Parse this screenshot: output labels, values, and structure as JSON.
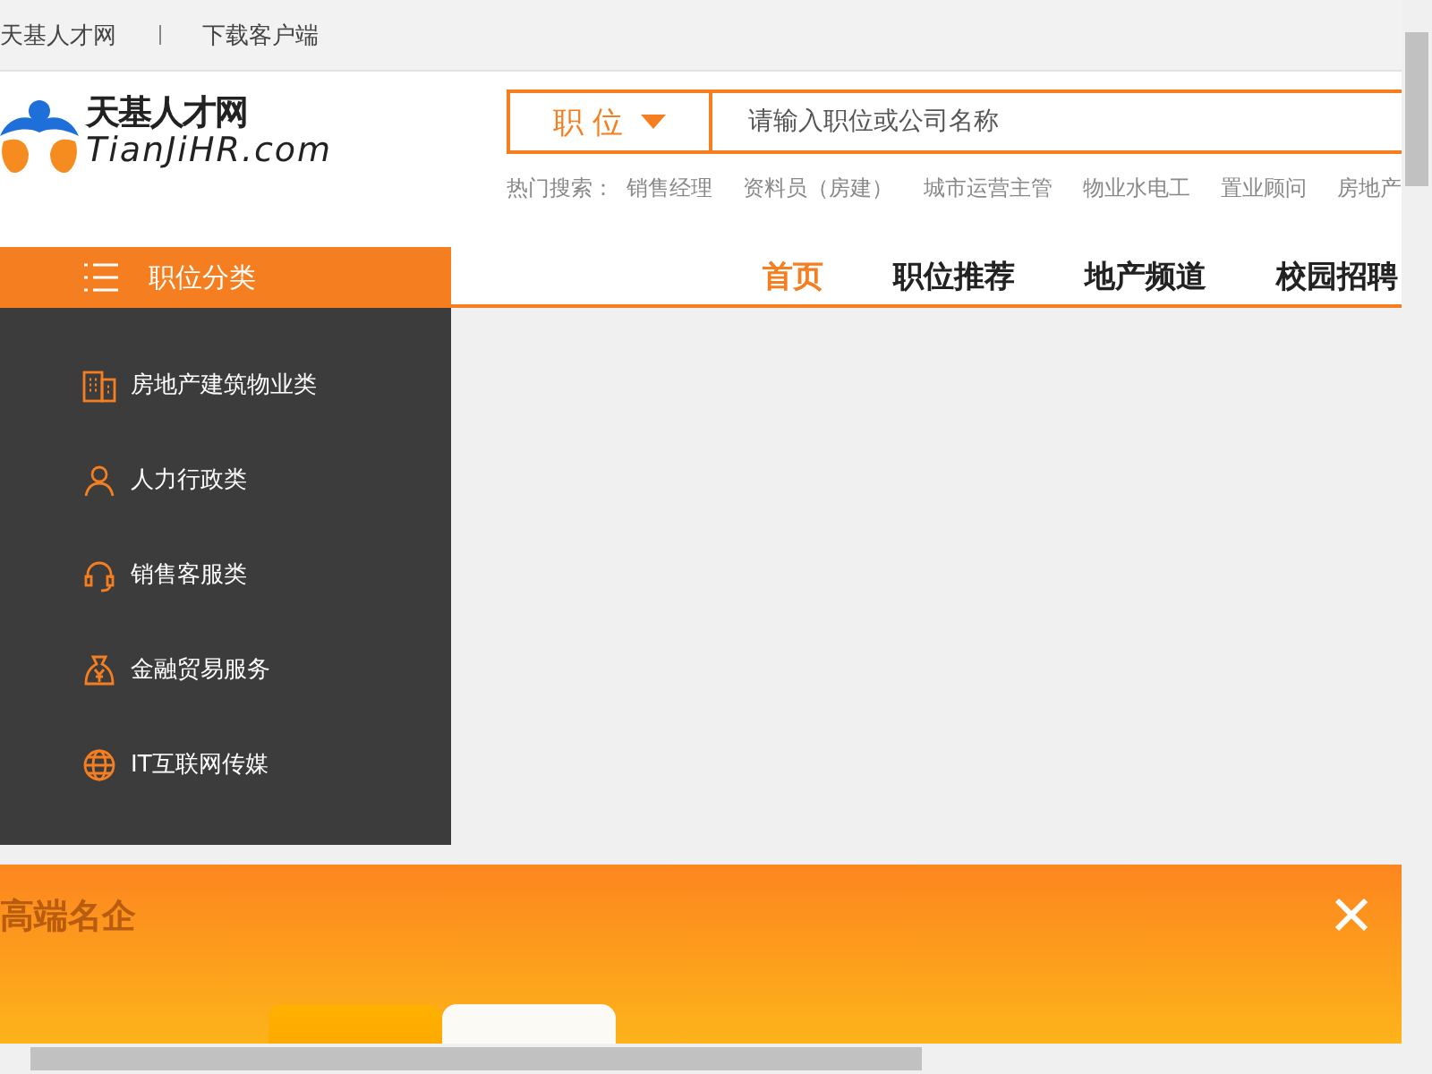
{
  "top_bar": {
    "links": [
      "天基人才网",
      "下载客户端"
    ]
  },
  "logo": {
    "name": "天基人才网",
    "domain": "TianJiHR.com"
  },
  "search": {
    "category": "职 位",
    "placeholder": "请输入职位或公司名称"
  },
  "hot_search": {
    "label": "热门搜索：",
    "terms": [
      "销售经理",
      "资料员（房建）",
      "城市运营主管",
      "物业水电工",
      "置业顾问",
      "房地产"
    ]
  },
  "category_menu": {
    "title": "职位分类",
    "items": [
      {
        "label": "房地产建筑物业类",
        "kind": "building"
      },
      {
        "label": "人力行政类",
        "kind": "person"
      },
      {
        "label": "销售客服类",
        "kind": "headset"
      },
      {
        "label": "金融贸易服务",
        "kind": "moneybag"
      },
      {
        "label": "IT互联网传媒",
        "kind": "globe"
      }
    ]
  },
  "nav": [
    {
      "label": "首页",
      "selected": true
    },
    {
      "label": "职位推荐",
      "selected": false
    },
    {
      "label": "地产频道",
      "selected": false
    },
    {
      "label": "校园招聘",
      "selected": false
    }
  ],
  "banner": {
    "title": "高端名企",
    "tabs": [
      {
        "selected": true
      },
      {
        "selected": false
      }
    ]
  }
}
